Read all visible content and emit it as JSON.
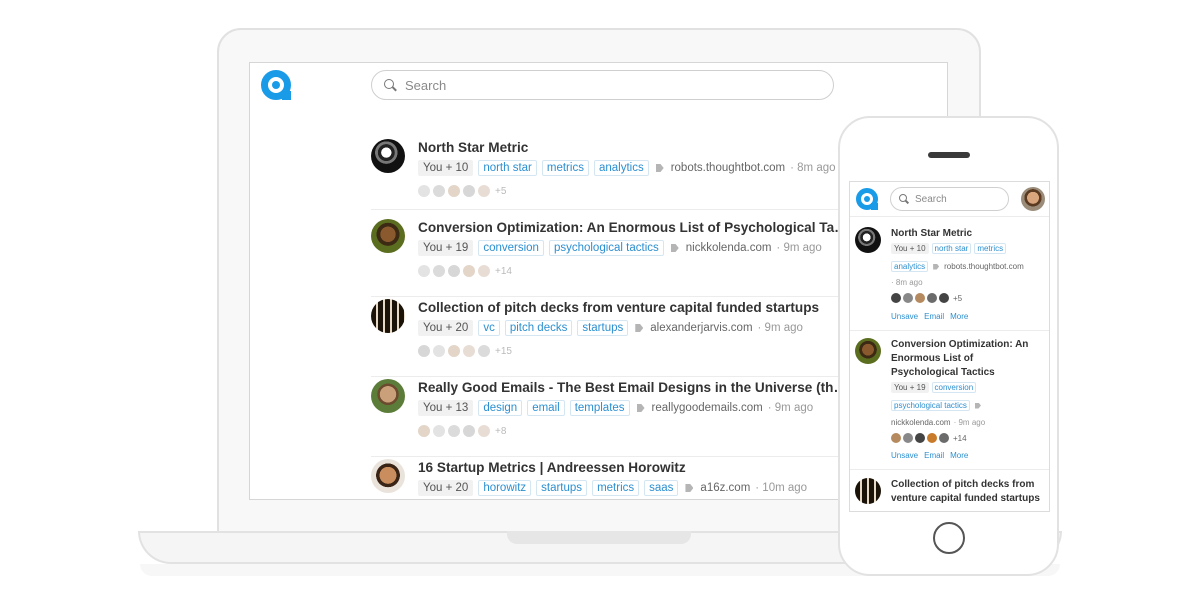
{
  "search": {
    "placeholder": "Search"
  },
  "feed": [
    {
      "title": "North Star Metric",
      "you": "You + 10",
      "tags": [
        "north star",
        "metrics",
        "analytics"
      ],
      "domain": "robots.thoughtbot.com",
      "ago": "· 8m ago",
      "extra": "+5"
    },
    {
      "title": "Conversion Optimization: An Enormous List of Psychological Ta…",
      "you": "You + 19",
      "tags": [
        "conversion",
        "psychological tactics"
      ],
      "domain": "nickkolenda.com",
      "ago": "· 9m ago",
      "extra": "+14"
    },
    {
      "title": "Collection of pitch decks from venture capital funded startups",
      "you": "You + 20",
      "tags": [
        "vc",
        "pitch decks",
        "startups"
      ],
      "domain": "alexanderjarvis.com",
      "ago": "· 9m ago",
      "extra": "+15"
    },
    {
      "title": "Really Good Emails - The Best Email Designs in the Universe (th…",
      "you": "You + 13",
      "tags": [
        "design",
        "email",
        "templates"
      ],
      "domain": "reallygoodemails.com",
      "ago": "· 9m ago",
      "extra": "+8"
    },
    {
      "title": "16 Startup Metrics | Andreessen Horowitz",
      "you": "You + 20",
      "tags": [
        "horowitz",
        "startups",
        "metrics",
        "saas"
      ],
      "domain": "a16z.com",
      "ago": "· 10m ago",
      "extra": ""
    }
  ],
  "mobile": {
    "search_placeholder": "Search",
    "items": [
      {
        "title": "North Star Metric",
        "you": "You + 10",
        "tags": [
          "north star",
          "metrics",
          "analytics"
        ],
        "domain": "robots.thoughtbot.com",
        "ago": "· 8m ago",
        "extra": "+5",
        "actions": [
          "Unsave",
          "Email",
          "More"
        ]
      },
      {
        "title": "Conversion Optimization: An Enormous List of Psychological Tactics",
        "you": "You + 19",
        "tags": [
          "conversion",
          "psychological tactics"
        ],
        "domain": "nickkolenda.com",
        "ago": "· 9m ago",
        "extra": "+14",
        "actions": [
          "Unsave",
          "Email",
          "More"
        ]
      },
      {
        "title": "Collection of pitch decks from venture capital funded startups"
      }
    ]
  },
  "colors": {
    "accent": "#1a9be8",
    "tag_text": "#2c8fd0"
  }
}
